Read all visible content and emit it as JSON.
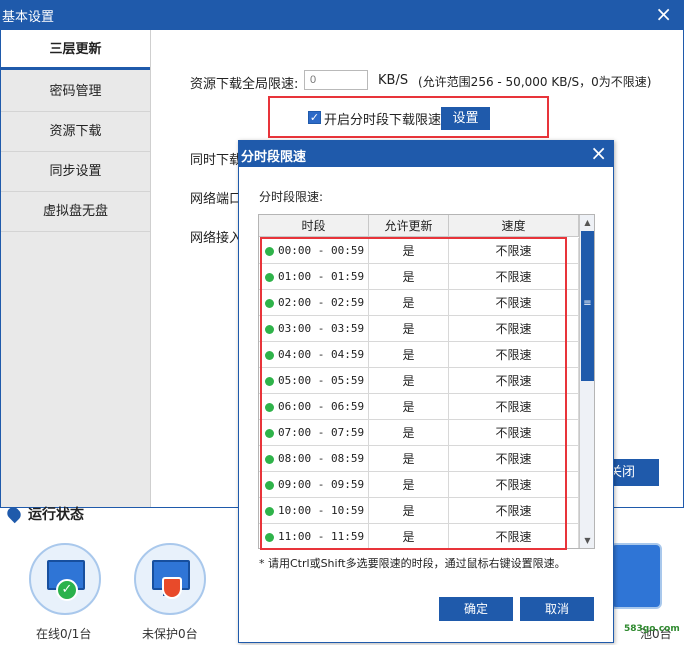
{
  "main_window": {
    "title": "基本设置",
    "close_glyph": "×",
    "close_behind_label": "关闭"
  },
  "sidebar": {
    "items": [
      {
        "label": "三层更新",
        "active": true
      },
      {
        "label": "密码管理"
      },
      {
        "label": "资源下载"
      },
      {
        "label": "同步设置"
      },
      {
        "label": "虚拟盘无盘"
      }
    ]
  },
  "settings": {
    "global_limit_label": "资源下载全局限速:",
    "global_limit_value": "",
    "global_limit_placeholder": "0",
    "global_limit_unit": "KB/S",
    "global_limit_hint": "(允许范围256 - 50,000 KB/S，0为不限速)",
    "timed_limit_checked": true,
    "timed_limit_label": "开启分时段下载限速",
    "timed_limit_button": "设置",
    "partial_labels": [
      "同时下载",
      "网络端口",
      "网络接入"
    ]
  },
  "status": {
    "title": "运行状态",
    "items": [
      {
        "label": "在线0/1台",
        "icon": "monitor-online-icon"
      },
      {
        "label": "未保护0台",
        "icon": "monitor-shield-icon"
      }
    ],
    "partial_right_label": "池0台"
  },
  "dialog": {
    "title": "分时段限速",
    "close_glyph": "×",
    "subtitle": "分时段限速:",
    "columns": [
      "时段",
      "允许更新",
      "速度"
    ],
    "rows": [
      {
        "time": "00:00 - 00:59",
        "allow": "是",
        "speed": "不限速"
      },
      {
        "time": "01:00 - 01:59",
        "allow": "是",
        "speed": "不限速"
      },
      {
        "time": "02:00 - 02:59",
        "allow": "是",
        "speed": "不限速"
      },
      {
        "time": "03:00 - 03:59",
        "allow": "是",
        "speed": "不限速"
      },
      {
        "time": "04:00 - 04:59",
        "allow": "是",
        "speed": "不限速"
      },
      {
        "time": "05:00 - 05:59",
        "allow": "是",
        "speed": "不限速"
      },
      {
        "time": "06:00 - 06:59",
        "allow": "是",
        "speed": "不限速"
      },
      {
        "time": "07:00 - 07:59",
        "allow": "是",
        "speed": "不限速"
      },
      {
        "time": "08:00 - 08:59",
        "allow": "是",
        "speed": "不限速"
      },
      {
        "time": "09:00 - 09:59",
        "allow": "是",
        "speed": "不限速"
      },
      {
        "time": "10:00 - 10:59",
        "allow": "是",
        "speed": "不限速"
      },
      {
        "time": "11:00 - 11:59",
        "allow": "是",
        "speed": "不限速"
      }
    ],
    "note": "* 请用Ctrl或Shift多选要限速的时段，通过鼠标右键设置限速。",
    "ok_label": "确定",
    "cancel_label": "取消",
    "scroll_up_glyph": "▲",
    "scroll_down_glyph": "▼",
    "scroll_grip_glyph": "≡"
  },
  "watermark": "583go.com",
  "colors": {
    "accent": "#1f5aab",
    "highlight": "#e8343a",
    "status_dot": "#2fb34a"
  }
}
